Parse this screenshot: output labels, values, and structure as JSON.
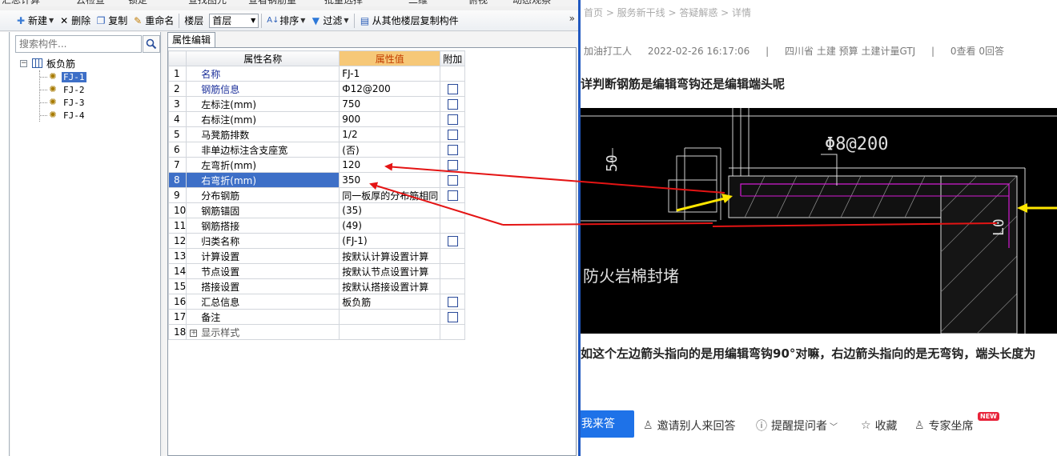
{
  "app": {
    "top_toolbar_cut": [
      "汇总计算",
      "云检查",
      "锁定",
      "查找图元",
      "查看钢筋量",
      "批量选择",
      "二维",
      "俯视",
      "动态观察"
    ],
    "toolbar": {
      "new_label": "新建",
      "delete_label": "删除",
      "copy_label": "复制",
      "rename_label": "重命名",
      "floor_label": "楼层",
      "floor_value": "首层",
      "sort_label": "排序",
      "filter_label": "过滤",
      "copy_from_floor_label": "从其他楼层复制构件",
      "more_label": "»"
    },
    "search": {
      "placeholder": "搜索构件..."
    },
    "tree": {
      "root_label": "板负筋",
      "root_expander": "−",
      "items": [
        {
          "label": "FJ-1",
          "selected": true
        },
        {
          "label": "FJ-2",
          "selected": false
        },
        {
          "label": "FJ-3",
          "selected": false
        },
        {
          "label": "FJ-4",
          "selected": false
        }
      ]
    },
    "props": {
      "tab_label": "属性编辑",
      "headers": {
        "name": "属性名称",
        "value": "属性值",
        "extra": "附加"
      },
      "rows": [
        {
          "n": "1",
          "name": "名称",
          "value": "FJ-1",
          "cb": false,
          "blue": true
        },
        {
          "n": "2",
          "name": "钢筋信息",
          "value": "Ф12@200",
          "cb": true,
          "blue": true
        },
        {
          "n": "3",
          "name": "左标注(mm)",
          "value": "750",
          "cb": true,
          "blue": false
        },
        {
          "n": "4",
          "name": "右标注(mm)",
          "value": "900",
          "cb": true,
          "blue": false
        },
        {
          "n": "5",
          "name": "马凳筋排数",
          "value": "1/2",
          "cb": true,
          "blue": false
        },
        {
          "n": "6",
          "name": "非单边标注含支座宽",
          "value": "(否)",
          "cb": true,
          "blue": false
        },
        {
          "n": "7",
          "name": "左弯折(mm)",
          "value": "120",
          "cb": true,
          "blue": false
        },
        {
          "n": "8",
          "name": "右弯折(mm)",
          "value": "350",
          "cb": true,
          "blue": false,
          "selected": true
        },
        {
          "n": "9",
          "name": "分布钢筋",
          "value": "同一板厚的分布筋相同",
          "cb": true,
          "blue": false
        },
        {
          "n": "10",
          "name": "钢筋锚固",
          "value": "(35)",
          "cb": false,
          "blue": false
        },
        {
          "n": "11",
          "name": "钢筋搭接",
          "value": "(49)",
          "cb": false,
          "blue": false
        },
        {
          "n": "12",
          "name": "归类名称",
          "value": "(FJ-1)",
          "cb": true,
          "blue": false
        },
        {
          "n": "13",
          "name": "计算设置",
          "value": "按默认计算设置计算",
          "cb": false,
          "blue": false
        },
        {
          "n": "14",
          "name": "节点设置",
          "value": "按默认节点设置计算",
          "cb": false,
          "blue": false
        },
        {
          "n": "15",
          "name": "搭接设置",
          "value": "按默认搭接设置计算",
          "cb": false,
          "blue": false
        },
        {
          "n": "16",
          "name": "汇总信息",
          "value": "板负筋",
          "cb": true,
          "blue": false
        },
        {
          "n": "17",
          "name": "备注",
          "value": "",
          "cb": true,
          "blue": false
        },
        {
          "n": "18",
          "name": "显示样式",
          "value": "",
          "cb": false,
          "blue": false,
          "expander": "+"
        }
      ]
    }
  },
  "web": {
    "breadcrumb": "首页 > 服务新干线 > 答疑解惑 > 详情",
    "meta": {
      "author": "加油打工人",
      "time": "2022-02-26 16:17:06",
      "sep": "|",
      "tags": "四川省 土建 预算 土建计量GTJ",
      "stats": "0查看 0回答"
    },
    "question_title": "详判断钢筋是编辑弯钩还是编辑端头呢",
    "question_body": "如这个左边箭头指向的是用编辑弯钩90°对嘛，右边箭头指向的是无弯钩，端头长度为",
    "cad": {
      "rebar_label": "Φ8@200",
      "left_dim": "50",
      "right_dim": "L0",
      "fire_note": "防火岩棉封堵"
    },
    "actions": {
      "answer": "我来答",
      "invite": "邀请别人来回答",
      "remind": "提醒提问者",
      "favorite": "收藏",
      "expert": "专家坐席",
      "new_badge": "NEW"
    }
  },
  "colors": {
    "selection_blue": "#3d6fc7",
    "value_header": "#f6c878",
    "arrow_red": "#e41414",
    "arrow_yellow": "#ffe600",
    "answer_blue": "#1e72e8"
  }
}
